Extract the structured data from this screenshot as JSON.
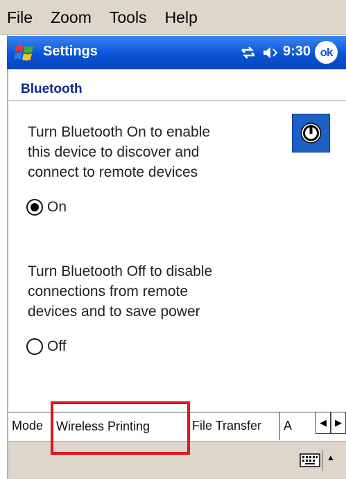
{
  "menubar": {
    "items": [
      {
        "label": "File"
      },
      {
        "label": "Zoom"
      },
      {
        "label": "Tools"
      },
      {
        "label": "Help"
      }
    ]
  },
  "titlebar": {
    "title": "Settings",
    "time": "9:30",
    "ok_label": "ok",
    "icons": [
      "windows-start-icon",
      "sync-status-icon",
      "volume-icon"
    ]
  },
  "page": {
    "title": "Bluetooth",
    "on_description": "Turn Bluetooth On to enable\nthis device to discover and\nconnect to remote devices",
    "on_label": "On",
    "on_selected": true,
    "off_description": "Turn Bluetooth Off to disable\nconnections from remote\ndevices and to save power",
    "off_label": "Off",
    "off_selected": false,
    "power_icon": "power-icon"
  },
  "tabs": {
    "items": [
      {
        "label": "Mode"
      },
      {
        "label": "Wireless Printing"
      },
      {
        "label": "File Transfer"
      },
      {
        "label": "A"
      }
    ],
    "active_index": 1,
    "scroll_left_icon": "arrow-left-icon",
    "scroll_right_icon": "arrow-right-icon"
  },
  "bottombar": {
    "keyboard_icon": "keyboard-icon",
    "input_menu_icon": "caret-up-icon"
  },
  "colors": {
    "titlebar": "#0a53d6",
    "page_title": "#0b2b8c",
    "highlight": "#e2161b",
    "chrome": "#dcd6cb"
  }
}
